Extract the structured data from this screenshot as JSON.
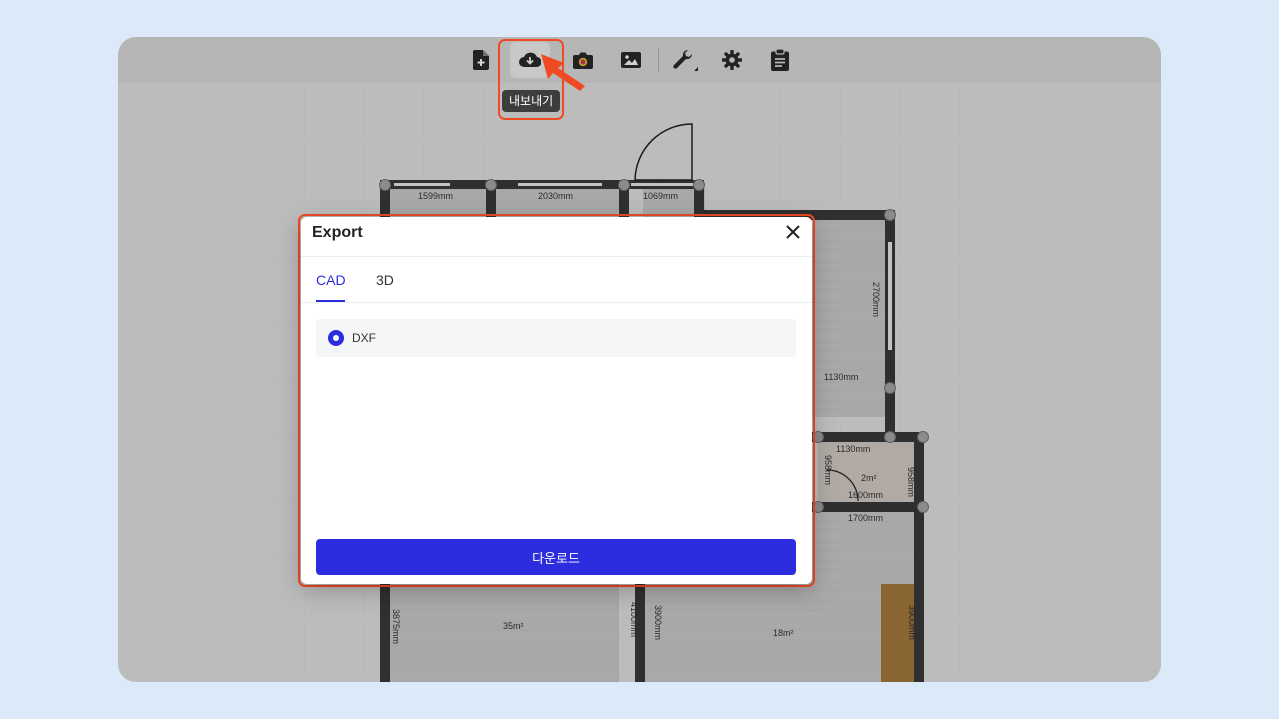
{
  "toolbar": {
    "buttons": [
      {
        "name": "new-file",
        "icon": "file-plus-icon"
      },
      {
        "name": "export",
        "icon": "cloud-download-icon",
        "active": true
      },
      {
        "name": "camera",
        "icon": "camera-icon"
      },
      {
        "name": "image",
        "icon": "image-icon"
      },
      {
        "name": "tools",
        "icon": "wrench-icon"
      },
      {
        "name": "settings",
        "icon": "gear-icon"
      },
      {
        "name": "clipboard",
        "icon": "clipboard-icon"
      }
    ],
    "export_tooltip": "내보내기"
  },
  "floorplan": {
    "dimensions": [
      "1599mm",
      "2030mm",
      "1069mm",
      "1130mm",
      "2700mm",
      "1130mm",
      "1600mm",
      "1700mm",
      "958mm",
      "958mm",
      "3875mm",
      "4100mm",
      "3900mm",
      "3900mm"
    ],
    "areas": [
      "2m²",
      "35m²",
      "18m²"
    ]
  },
  "dialog": {
    "title": "Export",
    "tabs": [
      "CAD",
      "3D"
    ],
    "selected_tab": "CAD",
    "option_label": "DXF",
    "download_label": "다운로드"
  },
  "colors": {
    "accent": "#2d2de0",
    "highlight": "#f04a24",
    "background": "#dbe9f8"
  }
}
